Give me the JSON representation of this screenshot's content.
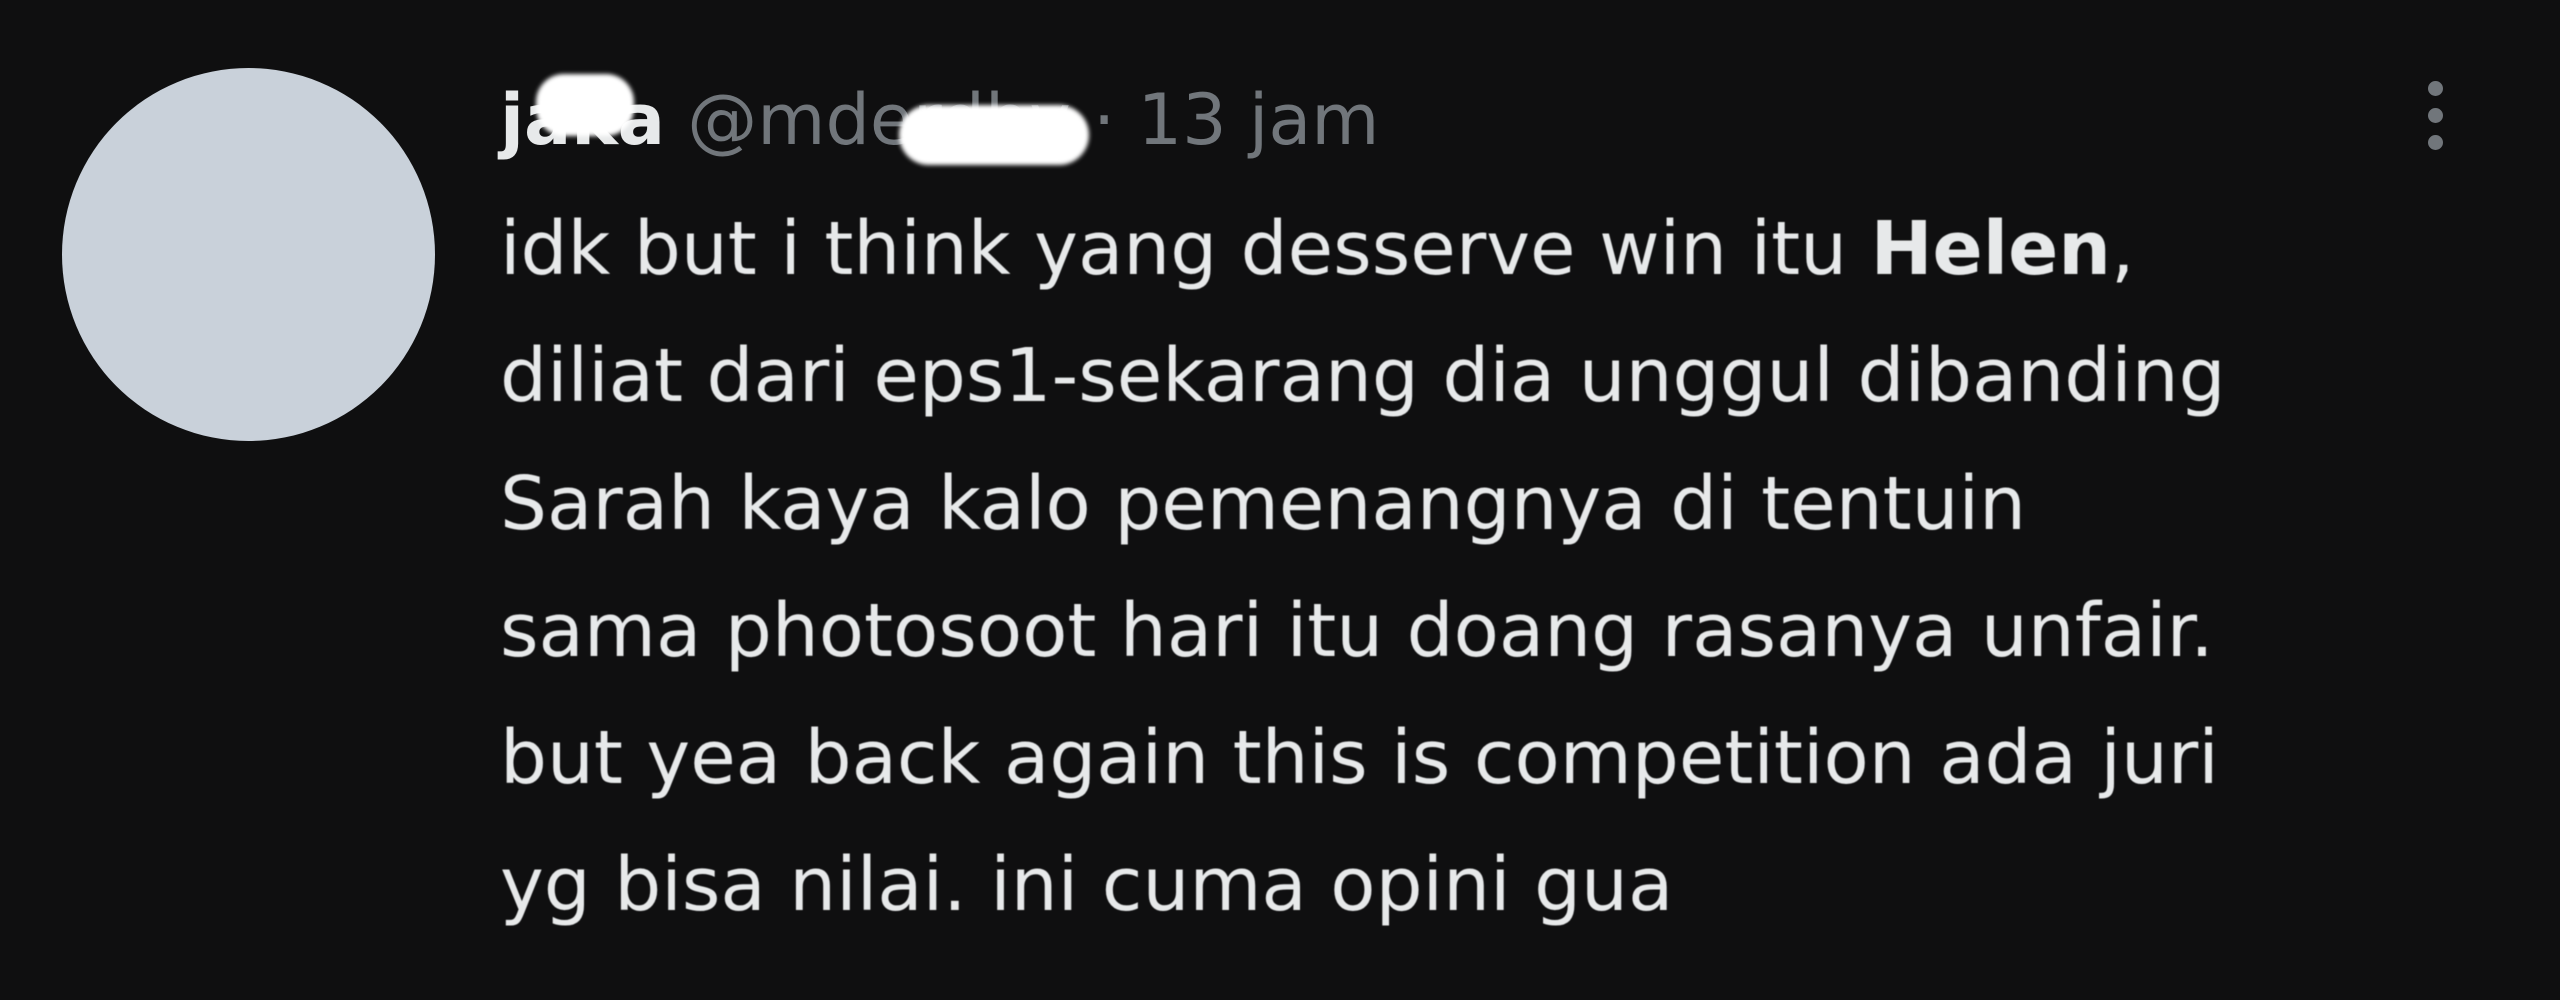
{
  "tweet": {
    "display_name": "jaka",
    "handle": "@mderdhy",
    "separator": "·",
    "time": "13 jam",
    "text_before_bold": "idk but i think yang desserve win itu ",
    "text_bold": "Helen",
    "text_after_bold": ",\ndiliat dari eps1-sekarang dia unggul dibanding\nSarah kaya kalo pemenangnya di tentuin\nsama photosoot hari itu doang rasanya unfair.\nbut yea back again this is competition ada juri\nyg bisa nilai. ini cuma opini gua",
    "more_icon": "more-options-vertical-icon"
  },
  "colors": {
    "background": "#0f0f10",
    "primary_text": "#e7e9ea",
    "secondary_text": "#71767b",
    "avatar": "#c9d1da"
  }
}
